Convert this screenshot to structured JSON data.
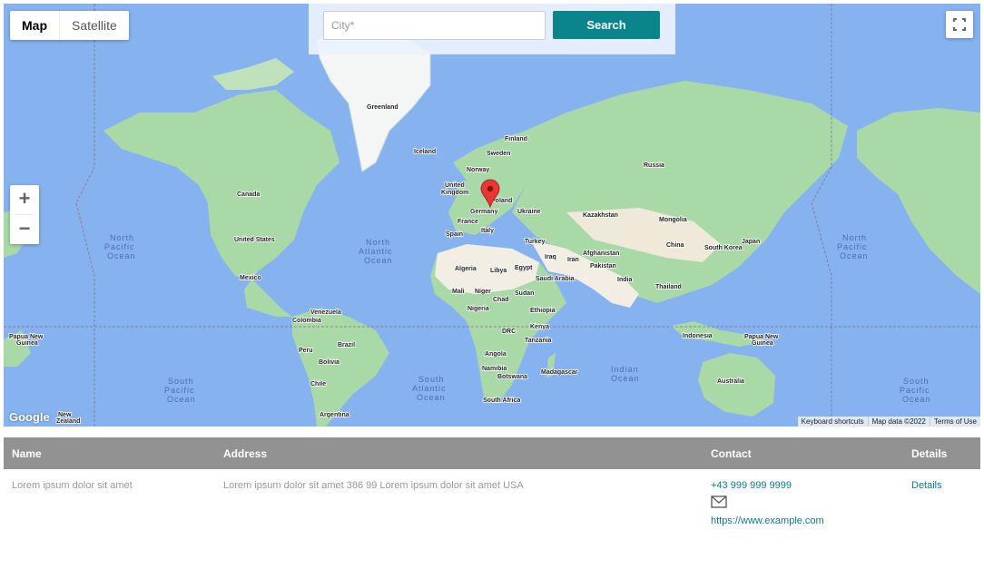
{
  "map": {
    "type_buttons": {
      "map": "Map",
      "satellite": "Satellite"
    },
    "search": {
      "placeholder": "City*",
      "button": "Search"
    },
    "labels": {
      "greenland": "Greenland",
      "iceland": "Iceland",
      "finland": "Finland",
      "sweden": "Sweden",
      "norway": "Norway",
      "united_kingdom_1": "United",
      "united_kingdom_2": "Kingdom",
      "poland": "Poland",
      "germany": "Germany",
      "ukraine": "Ukraine",
      "france": "France",
      "spain": "Spain",
      "italy": "Italy",
      "turkey": "Turkey",
      "russia": "Russia",
      "kazakhstan": "Kazakhstan",
      "mongolia": "Mongolia",
      "china": "China",
      "south_korea": "South Korea",
      "japan": "Japan",
      "afghanistan": "Afghanistan",
      "iraq": "Iraq",
      "iran": "Iran",
      "pakistan": "Pakistan",
      "india": "India",
      "thailand": "Thailand",
      "algeria": "Algeria",
      "libya": "Libya",
      "egypt": "Egypt",
      "saudi_arabia": "Saudi Arabia",
      "mali": "Mali",
      "niger": "Niger",
      "chad": "Chad",
      "sudan": "Sudan",
      "nigeria": "Nigeria",
      "ethiopia": "Ethiopia",
      "drc": "DRC",
      "kenya": "Kenya",
      "tanzania": "Tanzania",
      "angola": "Angola",
      "namibia": "Namibia",
      "botswana": "Botswana",
      "madagascar": "Madagascar",
      "south_africa": "South Africa",
      "canada": "Canada",
      "united_states": "United States",
      "mexico": "Mexico",
      "venezuela": "Venezuela",
      "colombia": "Colombia",
      "brazil": "Brazil",
      "peru": "Peru",
      "bolivia": "Bolivia",
      "chile": "Chile",
      "argentina": "Argentina",
      "indonesia": "Indonesia",
      "papua_new_guinea_1": "Papua New",
      "papua_new_guinea_2": "Guinea",
      "australia": "Australia",
      "new_zealand_1": "New",
      "new_zealand_2": "Zealand"
    },
    "oceans": {
      "north_pacific_1": "North",
      "north_pacific_2": "Pacific",
      "north_pacific_3": "Ocean",
      "north_atlantic_1": "North",
      "north_atlantic_2": "Atlantic",
      "north_atlantic_3": "Ocean",
      "south_pacific_1": "South",
      "south_pacific_2": "Pacific",
      "south_pacific_3": "Ocean",
      "south_atlantic_1": "South",
      "south_atlantic_2": "Atlantic",
      "south_atlantic_3": "Ocean",
      "indian_1": "Indian",
      "indian_2": "Ocean"
    },
    "google": "Google",
    "attribution": {
      "shortcuts": "Keyboard shortcuts",
      "data": "Map data ©2022",
      "terms": "Terms of Use"
    },
    "colors": {
      "water": "#86b3f0",
      "land": "#a9d9a7",
      "desert": "#f3eee4",
      "marker": "#e53935"
    },
    "icons": {
      "zoom_in": "plus-icon",
      "zoom_out": "minus-icon",
      "fullscreen": "fullscreen-icon",
      "marker": "map-pin-icon"
    }
  },
  "table": {
    "headers": {
      "name": "Name",
      "address": "Address",
      "contact": "Contact",
      "details": "Details"
    },
    "rows": [
      {
        "name": "Lorem ipsum dolor sit amet",
        "address": "Lorem ipsum dolor sit amet 386 99 Lorem ipsum dolor sit amet USA",
        "phone": "+43 999 999 9999",
        "url": "https://www.example.com",
        "details": "Details"
      }
    ]
  },
  "accent_color": "#0a858b"
}
